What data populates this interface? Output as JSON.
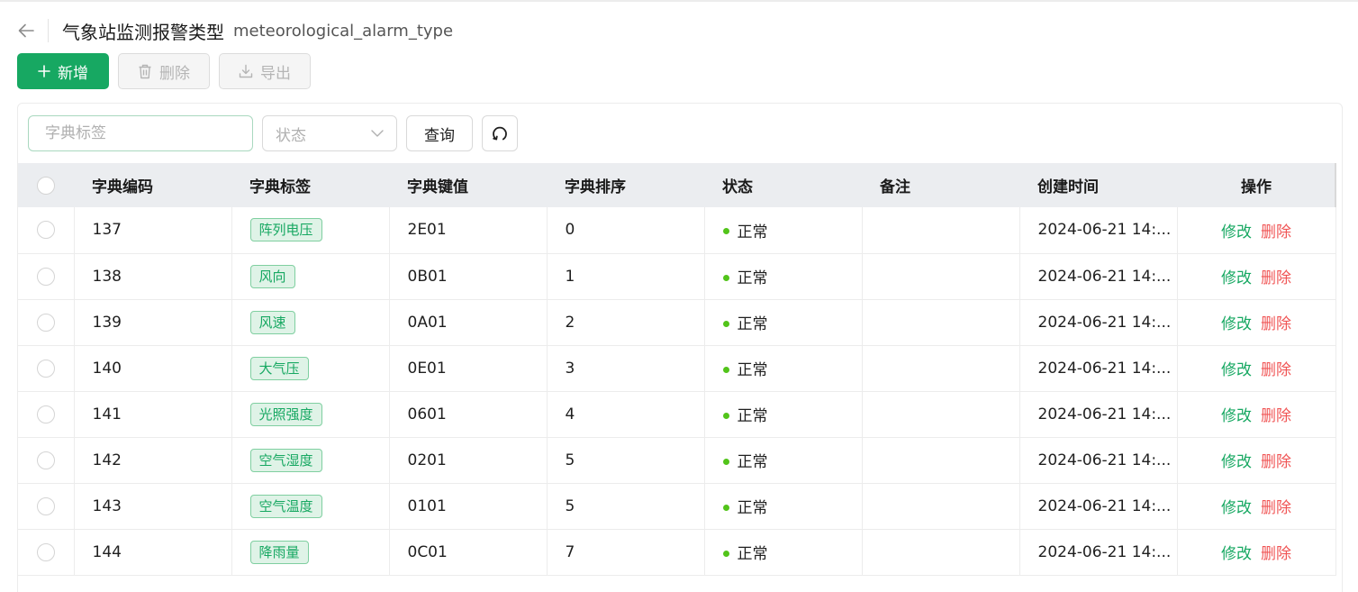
{
  "header": {
    "title": "气象站监测报警类型",
    "subtitle": "meteorological_alarm_type"
  },
  "toolbar": {
    "add_label": "新增",
    "delete_label": "删除",
    "export_label": "导出"
  },
  "filters": {
    "search_placeholder": "字典标签",
    "status_placeholder": "状态",
    "query_label": "查询"
  },
  "table": {
    "columns": [
      "字典编码",
      "字典标签",
      "字典键值",
      "字典排序",
      "状态",
      "备注",
      "创建时间",
      "操作"
    ],
    "actions": {
      "edit": "修改",
      "delete": "删除"
    },
    "rows": [
      {
        "code": "137",
        "label": "阵列电压",
        "key": "2E01",
        "sort": "0",
        "status": "正常",
        "remark": "",
        "created": "2024-06-21 14:..."
      },
      {
        "code": "138",
        "label": "风向",
        "key": "0B01",
        "sort": "1",
        "status": "正常",
        "remark": "",
        "created": "2024-06-21 14:..."
      },
      {
        "code": "139",
        "label": "风速",
        "key": "0A01",
        "sort": "2",
        "status": "正常",
        "remark": "",
        "created": "2024-06-21 14:..."
      },
      {
        "code": "140",
        "label": "大气压",
        "key": "0E01",
        "sort": "3",
        "status": "正常",
        "remark": "",
        "created": "2024-06-21 14:..."
      },
      {
        "code": "141",
        "label": "光照强度",
        "key": "0601",
        "sort": "4",
        "status": "正常",
        "remark": "",
        "created": "2024-06-21 14:..."
      },
      {
        "code": "142",
        "label": "空气湿度",
        "key": "0201",
        "sort": "5",
        "status": "正常",
        "remark": "",
        "created": "2024-06-21 14:..."
      },
      {
        "code": "143",
        "label": "空气温度",
        "key": "0101",
        "sort": "5",
        "status": "正常",
        "remark": "",
        "created": "2024-06-21 14:..."
      },
      {
        "code": "144",
        "label": "降雨量",
        "key": "0C01",
        "sort": "7",
        "status": "正常",
        "remark": "",
        "created": "2024-06-21 14:..."
      }
    ]
  },
  "colors": {
    "primary": "#17a862",
    "danger": "#f05656",
    "status_ok": "#52c41a",
    "header_bg": "#ebedf0"
  },
  "icons": {
    "back": "arrow-left-icon",
    "add": "plus-icon",
    "delete": "trash-icon",
    "export": "download-icon",
    "select": "chevron-down-icon",
    "refresh": "refresh-icon"
  }
}
